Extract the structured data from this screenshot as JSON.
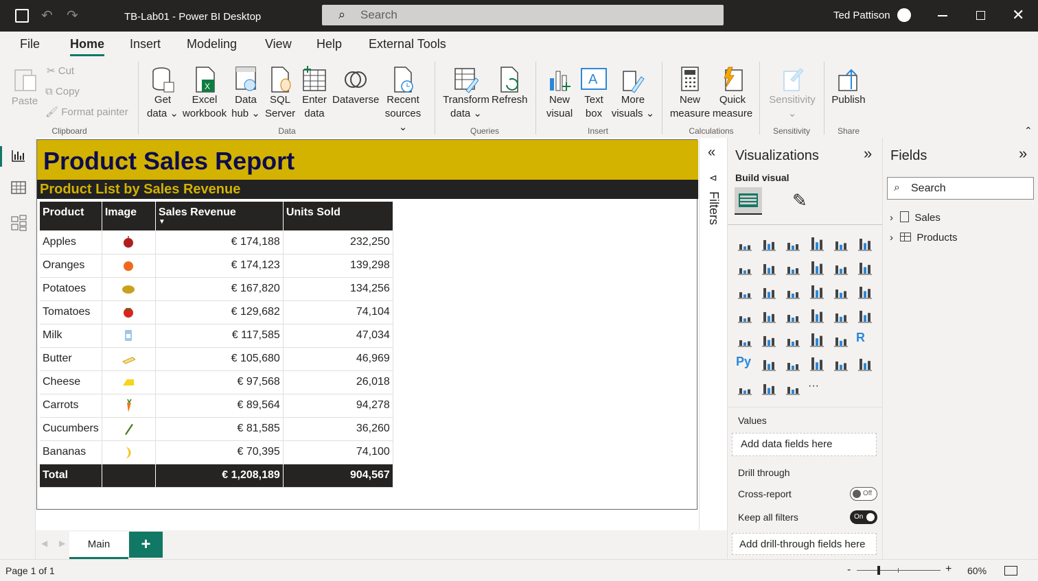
{
  "window": {
    "title": "TB-Lab01 - Power BI Desktop",
    "search_placeholder": "Search",
    "user": "Ted Pattison"
  },
  "menu_tabs": [
    "File",
    "Home",
    "Insert",
    "Modeling",
    "View",
    "Help",
    "External Tools"
  ],
  "ribbon": {
    "paste": "Paste",
    "cut": "Cut",
    "copy": "Copy",
    "format_painter": "Format painter",
    "clipboard_group": "Clipboard",
    "get_data_1": "Get",
    "get_data_2": "data ⌄",
    "excel_1": "Excel",
    "excel_2": "workbook",
    "datahub_1": "Data",
    "datahub_2": "hub ⌄",
    "sql_1": "SQL",
    "sql_2": "Server",
    "enter_1": "Enter",
    "enter_2": "data",
    "dataverse": "Dataverse",
    "recent_1": "Recent",
    "recent_2": "sources ⌄",
    "data_group": "Data",
    "transform_1": "Transform",
    "transform_2": "data ⌄",
    "refresh": "Refresh",
    "queries_group": "Queries",
    "newvisual_1": "New",
    "newvisual_2": "visual",
    "textbox_1": "Text",
    "textbox_2": "box",
    "morevis_1": "More",
    "morevis_2": "visuals ⌄",
    "insert_group": "Insert",
    "newmeasure_1": "New",
    "newmeasure_2": "measure",
    "quickmeasure_1": "Quick",
    "quickmeasure_2": "measure",
    "calc_group": "Calculations",
    "sensitivity": "Sensitivity",
    "sensitivity_chev": "⌄",
    "sensitivity_group": "Sensitivity",
    "publish": "Publish",
    "share_group": "Share"
  },
  "report": {
    "title": "Product Sales Report",
    "subtitle": "Product List by Sales Revenue",
    "columns": [
      "Product",
      "Image",
      "Sales Revenue",
      "Units Sold"
    ],
    "rows": [
      {
        "product": "Apples",
        "image": "apple",
        "revenue": "€ 174,188",
        "units": "232,250"
      },
      {
        "product": "Oranges",
        "image": "orange",
        "revenue": "€ 174,123",
        "units": "139,298"
      },
      {
        "product": "Potatoes",
        "image": "potato",
        "revenue": "€ 167,820",
        "units": "134,256"
      },
      {
        "product": "Tomatoes",
        "image": "tomato",
        "revenue": "€ 129,682",
        "units": "74,104"
      },
      {
        "product": "Milk",
        "image": "milk",
        "revenue": "€ 117,585",
        "units": "47,034"
      },
      {
        "product": "Butter",
        "image": "butter",
        "revenue": "€ 105,680",
        "units": "46,969"
      },
      {
        "product": "Cheese",
        "image": "cheese",
        "revenue": "€ 97,568",
        "units": "26,018"
      },
      {
        "product": "Carrots",
        "image": "carrot",
        "revenue": "€ 89,564",
        "units": "94,278"
      },
      {
        "product": "Cucumbers",
        "image": "cucumber",
        "revenue": "€ 81,585",
        "units": "36,260"
      },
      {
        "product": "Bananas",
        "image": "banana",
        "revenue": "€ 70,395",
        "units": "74,100"
      }
    ],
    "total": {
      "label": "Total",
      "revenue": "€ 1,208,189",
      "units": "904,567"
    }
  },
  "filters_label": "Filters",
  "visualizations": {
    "title": "Visualizations",
    "build_visual": "Build visual",
    "values": "Values",
    "add_data": "Add data fields here",
    "drill_through": "Drill through",
    "cross_report": "Cross-report",
    "cross_report_state": "Off",
    "keep_filters": "Keep all filters",
    "keep_filters_state": "On",
    "add_drill": "Add drill-through fields here"
  },
  "fields": {
    "title": "Fields",
    "search_placeholder": "Search",
    "tables": [
      "Sales",
      "Products"
    ]
  },
  "pages": {
    "current": "Main",
    "add": "+"
  },
  "status": {
    "page": "Page 1 of 1",
    "zoom": "60%"
  },
  "colors": {
    "accent": "#117865",
    "title_bg": "#d4b200",
    "title_text": "#0d0d4d"
  }
}
